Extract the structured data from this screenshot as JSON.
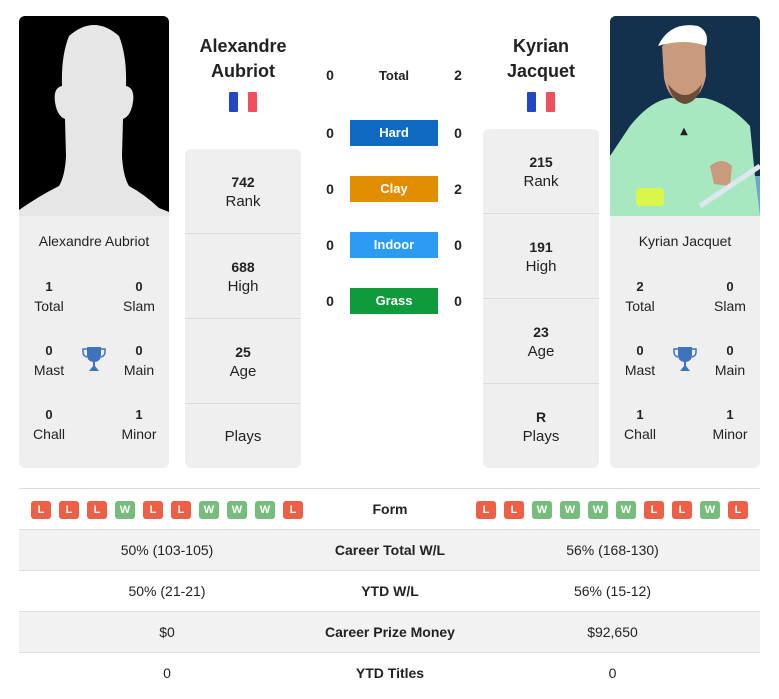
{
  "colors": {
    "hard": "#0f6bc1",
    "clay": "#df8e00",
    "indoor": "#2b9cf2",
    "grass": "#0f9a3c",
    "loss": "#ee5f48",
    "win": "#77bc7d",
    "trophy": "#3f73bd",
    "flag_blue": "#2147c4",
    "flag_red": "#f0505d"
  },
  "player1": {
    "name_line1": "Alexandre",
    "name_line2": "Aubriot",
    "full_name": "Alexandre Aubriot",
    "flag": "France",
    "photo": "silhouette-placeholder",
    "rank": {
      "value": "742",
      "label": "Rank"
    },
    "high": {
      "value": "688",
      "label": "High"
    },
    "age": {
      "value": "25",
      "label": "Age"
    },
    "plays": {
      "value": "",
      "label": "Plays"
    },
    "titles": {
      "total": {
        "value": "1",
        "label": "Total"
      },
      "slam": {
        "value": "0",
        "label": "Slam"
      },
      "mast": {
        "value": "0",
        "label": "Mast"
      },
      "main": {
        "value": "0",
        "label": "Main"
      },
      "chall": {
        "value": "0",
        "label": "Chall"
      },
      "minor": {
        "value": "1",
        "label": "Minor"
      }
    },
    "form": [
      "L",
      "L",
      "L",
      "W",
      "L",
      "L",
      "W",
      "W",
      "W",
      "L"
    ]
  },
  "player2": {
    "name_line1": "Kyrian",
    "name_line2": "Jacquet",
    "full_name": "Kyrian Jacquet",
    "flag": "France",
    "photo": "player-photo",
    "rank": {
      "value": "215",
      "label": "Rank"
    },
    "high": {
      "value": "191",
      "label": "High"
    },
    "age": {
      "value": "23",
      "label": "Age"
    },
    "plays": {
      "value": "R",
      "label": "Plays"
    },
    "titles": {
      "total": {
        "value": "2",
        "label": "Total"
      },
      "slam": {
        "value": "0",
        "label": "Slam"
      },
      "mast": {
        "value": "0",
        "label": "Mast"
      },
      "main": {
        "value": "0",
        "label": "Main"
      },
      "chall": {
        "value": "1",
        "label": "Chall"
      },
      "minor": {
        "value": "1",
        "label": "Minor"
      }
    },
    "form": [
      "L",
      "L",
      "W",
      "W",
      "W",
      "W",
      "L",
      "L",
      "W",
      "L"
    ]
  },
  "h2h": {
    "total": {
      "label": "Total",
      "p1": "0",
      "p2": "2"
    },
    "surfaces": [
      {
        "key": "hard",
        "label": "Hard",
        "p1": "0",
        "p2": "0"
      },
      {
        "key": "clay",
        "label": "Clay",
        "p1": "0",
        "p2": "2"
      },
      {
        "key": "indoor",
        "label": "Indoor",
        "p1": "0",
        "p2": "0"
      },
      {
        "key": "grass",
        "label": "Grass",
        "p1": "0",
        "p2": "0"
      }
    ]
  },
  "comparison": {
    "form_label": "Form",
    "rows": [
      {
        "label": "Career Total W/L",
        "p1": "50% (103-105)",
        "p2": "56% (168-130)"
      },
      {
        "label": "YTD W/L",
        "p1": "50% (21-21)",
        "p2": "56% (15-12)"
      },
      {
        "label": "Career Prize Money",
        "p1": "$0",
        "p2": "$92,650"
      },
      {
        "label": "YTD Titles",
        "p1": "0",
        "p2": "0"
      }
    ]
  }
}
